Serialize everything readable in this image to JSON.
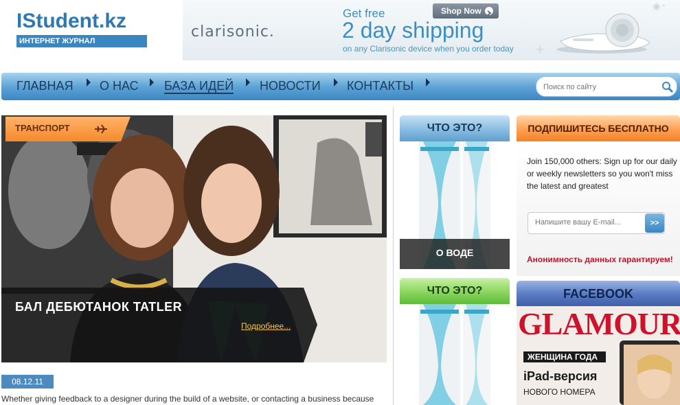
{
  "header": {
    "logo_title": "IStudent.kz",
    "logo_subtitle": "ИНТЕРНЕТ ЖУРНАЛ"
  },
  "banner": {
    "brand": "clarisonic.",
    "tagline_small": "Get free",
    "tagline_big": "2 day shipping",
    "tagline_sub": "on any Clarisonic device when you order today",
    "shop_button": "Shop Now"
  },
  "nav": {
    "items": [
      {
        "label": "ГЛАВНАЯ"
      },
      {
        "label": "О НАС"
      },
      {
        "label": "БАЗА ИДЕЙ"
      },
      {
        "label": "НОВОСТИ"
      },
      {
        "label": "КОНТАКТЫ"
      }
    ],
    "active": "БАЗА ИДЕЙ",
    "search_placeholder": "Поиск по сайту"
  },
  "article": {
    "category": "ТРАНСПОРТ",
    "title": "БАЛ ДЕБЮТАНОК TATLER",
    "more_link": "Подробнее...",
    "date": "08.12.11",
    "excerpt": "Whether giving feedback to a designer during the build of a website, or contacting a business because"
  },
  "widgets": {
    "what_is_1": {
      "title": "ЧТО ЭТО?",
      "caption": "О ВОДЕ"
    },
    "what_is_2": {
      "title": "ЧТО ЭТО?"
    },
    "subscribe": {
      "title": "ПОДПИШИТЕСЬ БЕСПЛАТНО",
      "text": "Join 150,000 others: Sign up for our daily or weekly newsletters so you won't miss the latest and greatest",
      "email_placeholder": "Напишите вашу E-mail...",
      "submit_label": ">>",
      "privacy": "Анонимность данных гарантируем!"
    },
    "facebook": {
      "title": "FACEBOOK",
      "magazine_name": "GLAMOUR",
      "magazine_line1": "ЖЕНЩИНА ГОДА",
      "magazine_line2": "iPad-версия",
      "magazine_line3": "НОВОГО НОМЕРА"
    }
  },
  "colors": {
    "brand_blue": "#2e78b4",
    "nav_blue": "#3b86c3",
    "accent_orange": "#f28224",
    "accent_green": "#5ebc38",
    "privacy_red": "#c0132a"
  }
}
